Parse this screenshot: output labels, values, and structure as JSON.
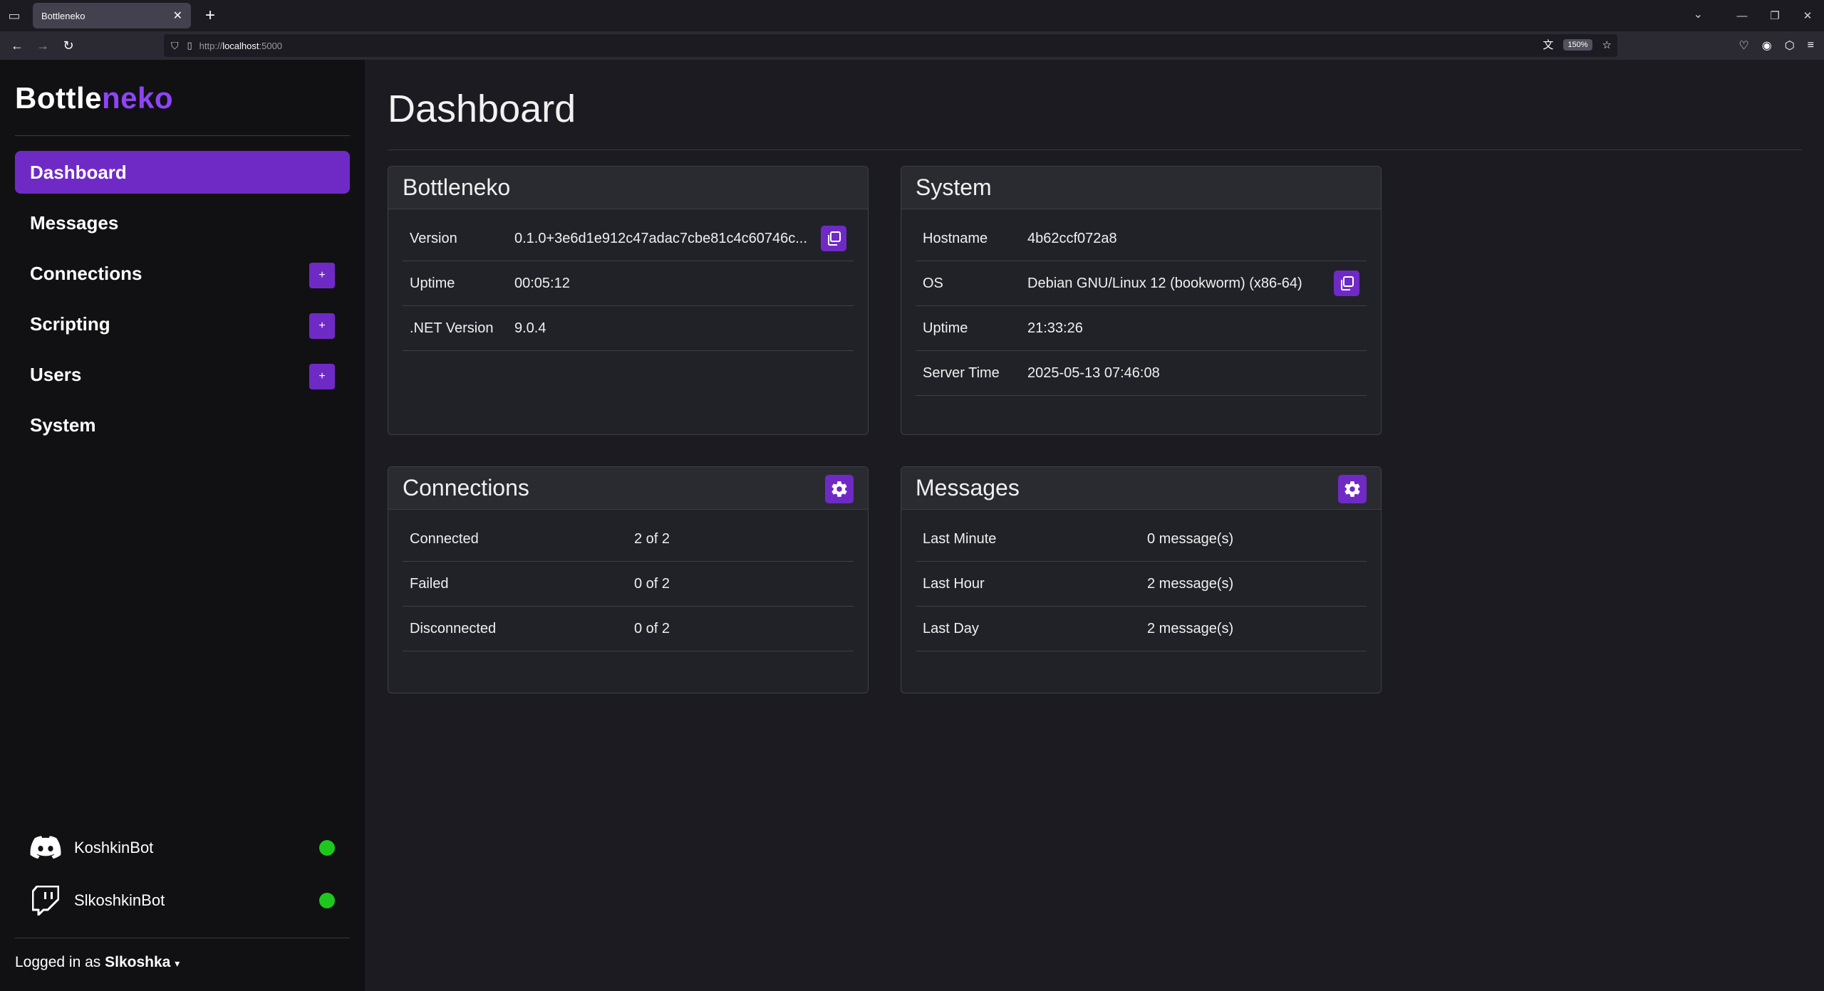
{
  "browser": {
    "tab_title": "Bottleneko",
    "url_proto": "http://",
    "url_host": "localhost",
    "url_port": ":5000",
    "zoom": "150%"
  },
  "sidebar": {
    "brand_main": "Bottle",
    "brand_accent": "neko",
    "items": [
      {
        "label": "Dashboard"
      },
      {
        "label": "Messages"
      },
      {
        "label": "Connections"
      },
      {
        "label": "Scripting"
      },
      {
        "label": "Users"
      },
      {
        "label": "System"
      }
    ],
    "plus_label": "+",
    "bots": [
      {
        "name": "KoshkinBot",
        "platform": "discord-icon",
        "status": "online"
      },
      {
        "name": "SlkoshkinBot",
        "platform": "twitch-icon",
        "status": "online"
      }
    ],
    "logged_prefix": "Logged in as",
    "logged_user": "Slkoshka"
  },
  "main": {
    "title": "Dashboard",
    "bottleneko": {
      "title": "Bottleneko",
      "rows": [
        {
          "label": "Version",
          "value": "0.1.0+3e6d1e912c47adac7cbe81c4c60746c..."
        },
        {
          "label": "Uptime",
          "value": "00:05:12"
        },
        {
          "label": ".NET Version",
          "value": "9.0.4"
        }
      ]
    },
    "system": {
      "title": "System",
      "rows": [
        {
          "label": "Hostname",
          "value": "4b62ccf072a8"
        },
        {
          "label": "OS",
          "value": "Debian GNU/Linux 12 (bookworm) (x86-64)"
        },
        {
          "label": "Uptime",
          "value": "21:33:26"
        },
        {
          "label": "Server Time",
          "value": "2025-05-13 07:46:08"
        }
      ]
    },
    "connections": {
      "title": "Connections",
      "rows": [
        {
          "label": "Connected",
          "value": "2 of 2"
        },
        {
          "label": "Failed",
          "value": "0 of 2"
        },
        {
          "label": "Disconnected",
          "value": "0 of 2"
        }
      ]
    },
    "messages": {
      "title": "Messages",
      "rows": [
        {
          "label": "Last Minute",
          "value": "0 message(s)"
        },
        {
          "label": "Last Hour",
          "value": "2 message(s)"
        },
        {
          "label": "Last Day",
          "value": "2 message(s)"
        }
      ]
    }
  },
  "colors": {
    "accent": "#6f2ac6",
    "brand_accent": "#8e44f5",
    "online": "#1ec71e"
  }
}
